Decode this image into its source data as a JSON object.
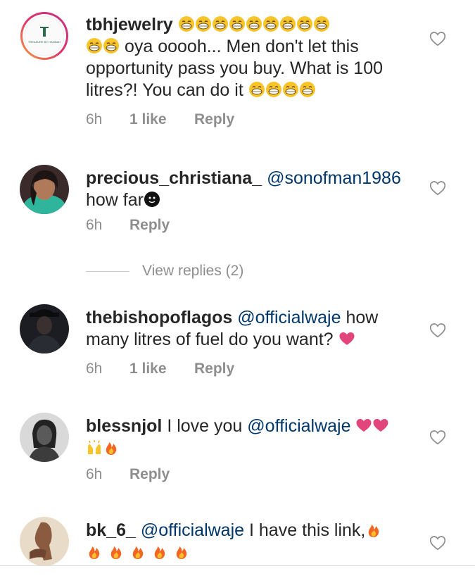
{
  "comments": [
    {
      "username": "tbhjewelry",
      "text_prefix": "",
      "mention": "",
      "text": "oya ooooh... Men don't let this opportunity pass you buy. What is 100 litres?! You can do it",
      "time": "6h",
      "likes": "1 like",
      "reply_label": "Reply",
      "avatar_logo_text": "TREASURE BY HANNAH"
    },
    {
      "username": "precious_christiana_",
      "mention": "@sonofman1986",
      "text": "how far",
      "time": "6h",
      "likes": "",
      "reply_label": "Reply"
    },
    {
      "username": "thebishopoflagos",
      "mention": "@officialwaje",
      "text": "how many litres of fuel do you want?",
      "time": "6h",
      "likes": "1 like",
      "reply_label": "Reply"
    },
    {
      "username": "blessnjol",
      "mention": "@officialwaje",
      "text_before_mention": "I love you",
      "time": "6h",
      "likes": "",
      "reply_label": "Reply"
    },
    {
      "username": "bk_6_",
      "mention": "@officialwaje",
      "text": "I have this link,",
      "time": "",
      "likes": "",
      "reply_label": ""
    }
  ],
  "view_replies": "View replies (2)",
  "colors": {
    "text": "#262626",
    "meta": "#8e8e8e",
    "mention": "#00376b",
    "heart_pink": "#e1306c",
    "emoji_yellow": "#f7c529",
    "fire": "#f26522"
  }
}
